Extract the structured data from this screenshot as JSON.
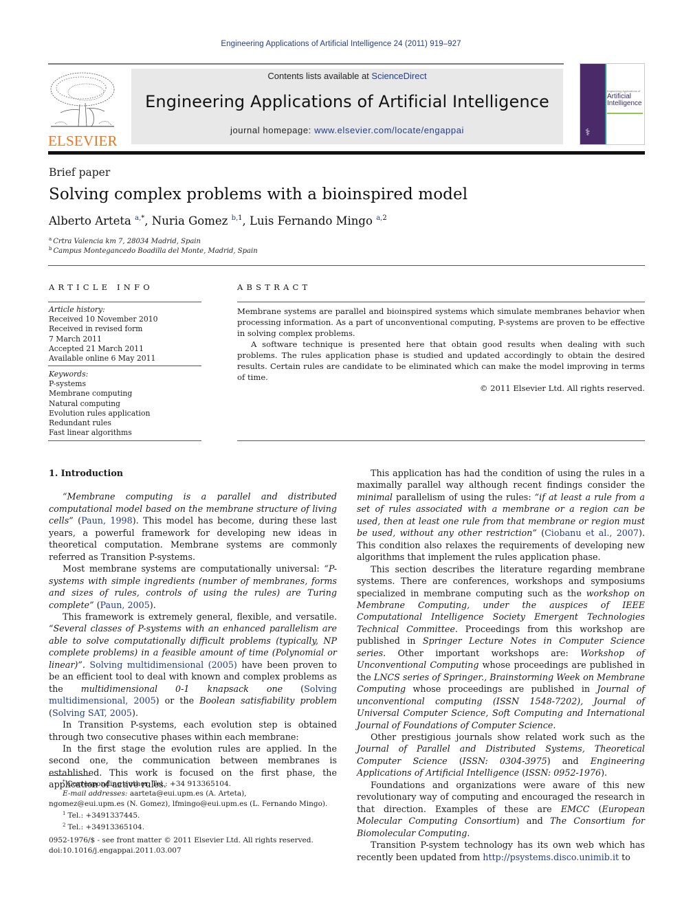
{
  "running_head": "Engineering Applications of Artificial Intelligence 24 (2011) 919–927",
  "publisher": {
    "name": "ELSEVIER",
    "logo_color": "#e87722"
  },
  "banner": {
    "contents_prefix": "Contents lists available at ",
    "contents_link": "ScienceDirect",
    "journal_title": "Engineering Applications of Artificial Intelligence",
    "homepage_prefix": "journal homepage: ",
    "homepage_link": "www.elsevier.com/locate/engappai"
  },
  "cover": {
    "line1": "Engineering Applications of",
    "line2": "Artificial",
    "line3": "Intelligence"
  },
  "article": {
    "type": "Brief paper",
    "title": "Solving complex problems with a bioinspired model",
    "authors": [
      {
        "name": "Alberto Arteta",
        "affil": "a,",
        "mark": "*",
        "sep": ", "
      },
      {
        "name": "Nuria Gomez",
        "affil": "b,",
        "mark": "1",
        "sep": ", "
      },
      {
        "name": "Luis Fernando Mingo",
        "affil": "a,",
        "mark": "2",
        "sep": ""
      }
    ],
    "affiliations": [
      {
        "key": "a",
        "text": "Crtra Valencia km 7, 28034 Madrid, Spain"
      },
      {
        "key": "b",
        "text": "Campus Montegancedo Boadilla del Monte, Madrid, Spain"
      }
    ]
  },
  "article_info": {
    "heading": "ARTICLE INFO",
    "history_label": "Article history:",
    "history": [
      "Received 10 November 2010",
      "Received in revised form",
      "7 March 2011",
      "Accepted 21 March 2011",
      "Available online 6 May 2011"
    ],
    "keywords_label": "Keywords:",
    "keywords": [
      "P-systems",
      "Membrane computing",
      "Natural computing",
      "Evolution rules application",
      "Redundant rules",
      "Fast linear algorithms"
    ]
  },
  "abstract": {
    "heading": "ABSTRACT",
    "p1": "Membrane systems are parallel and bioinspired systems which simulate membranes behavior when processing information. As a part of unconventional computing, P-systems are proven to be effective in solving complex problems.",
    "p2": "A software technique is presented here that obtain good results when dealing with such problems. The rules application phase is studied and updated accordingly to obtain the desired results. Certain rules are candidate to be eliminated which can make the model improving in terms of time.",
    "copyright": "© 2011 Elsevier Ltd. All rights reserved."
  },
  "body": {
    "section_heading": "1.  Introduction",
    "left": {
      "p1_quote": "“Membrane computing is a parallel and distributed computational model based on the membrane structure of living cells”",
      "p1_cite": "Paun, 1998",
      "p1_rest": ". This model has become, during these last years, a powerful framework for developing new ideas in theoretical computation. Membrane systems are commonly referred as Transition P-systems.",
      "p2_a": "Most membrane systems are computationally universal: ",
      "p2_quote": "“P-systems with simple ingredients (number of membranes, forms and sizes of rules, controls of using the rules) are Turing complete”",
      "p2_cite": "Paun, 2005",
      "p3_a": "This framework is extremely general, flexible, and versatile. ",
      "p3_quote": "“Several classes of P-systems with an enhanced parallelism are able to solve computationally difficult problems (typically, NP complete problems) in a feasible amount of time (Polynomial or linear)”.",
      "p3_cite1": "Solving multidimensional (2005)",
      "p3_b": " have been proven to be an efficient tool to deal with known and complex problems as the ",
      "p3_it1": "multidimensional 0-1 knapsack one",
      "p3_cite2": "Solving multidimensional, 2005",
      "p3_c": " or the ",
      "p3_it2": "Boolean satisfiability problem",
      "p3_cite3": "Solving SAT, 2005",
      "p4": "In Transition P-systems, each evolution step is obtained through two consecutive phases within each membrane:",
      "p5": "In the first stage the evolution rules are applied. In the second one, the communication between membranes is established. This work is focused on the first phase, the application of active rules."
    },
    "right": {
      "p1_a": "This application has had the condition of using the rules in a maximally parallel way although recent findings consider the ",
      "p1_it": "minimal",
      "p1_b": " parallelism of using the rules: ",
      "p1_quote": "“if at least a rule from a set of rules associated with a membrane or a region can be used, then at least one rule from that membrane or region must be used, without any other restriction”",
      "p1_cite": "Ciobanu et al., 2007",
      "p1_c": ". This condition also relaxes the requirements of developing new algorithms that implement the rules application phase.",
      "p2_a": "This section describes the literature regarding membrane systems. There are conferences, workshops and symposiums specialized in membrane computing such as the ",
      "p2_it1": "workshop on Membrane Computing, under the auspices of IEEE Computational Intelligence Society Emergent Technologies Technical Committee",
      "p2_b": ". Proceedings from this workshop are published in ",
      "p2_it2": "Springer Lecture Notes in Computer Science series",
      "p2_c": ". Other important workshops are: ",
      "p2_it3": "Workshop of Unconventional Computing",
      "p2_d": " whose proceedings are published in the ",
      "p2_it4": "LNCS series of Springer., Brainstorming Week on Membrane Computing",
      "p2_e": " whose proceedings are published in ",
      "p2_it5": "Journal of unconventional computing (ISSN 1548-7202), Journal of Universal Computer Science, Soft Computing and International Journal of Foundations of Computer Science.",
      "p3_a": "Other prestigious journals show related work such as the ",
      "p3_it1": "Journal of Parallel and Distributed Systems, Theoretical Computer Science",
      "p3_b": " (",
      "p3_it2": "ISSN: 0304-3975",
      "p3_c": ") and ",
      "p3_it3": "Engineering Applications of Artificial Intelligence",
      "p3_d": " (",
      "p3_it4": "ISSN: 0952-1976",
      "p3_e": ").",
      "p4_a": "Foundations and organizations were aware of this new revolutionary way of computing and encouraged the research in that direction. Examples of these are ",
      "p4_it1": "EMCC",
      "p4_b": " (",
      "p4_it2": "European Molecular Computing Consortium",
      "p4_c": ") and ",
      "p4_it3": "The Consortium for Biomolecular Computing.",
      "p5_a": "Transition P-system technology has its own web which has recently been updated from ",
      "p5_link": "http://psystems.disco.unimib.it",
      "p5_b": " to"
    }
  },
  "footnotes": {
    "corresponding": "Corresponding author. Tel.: +34 913365104.",
    "email_label": "E-mail addresses:",
    "email_line1": " aarteta@eui.upm.es (A. Arteta),",
    "email_line2": "ngomez@eui.upm.es (N. Gomez), lfmingo@eui.upm.es (L. Fernando Mingo).",
    "fn1": "Tel.: +3491337445.",
    "fn2": "Tel.: +34913365104."
  },
  "front_matter": {
    "line1": "0952-1976/$ - see front matter © 2011 Elsevier Ltd. All rights reserved.",
    "line2": "doi:10.1016/j.engappai.2011.03.007"
  }
}
